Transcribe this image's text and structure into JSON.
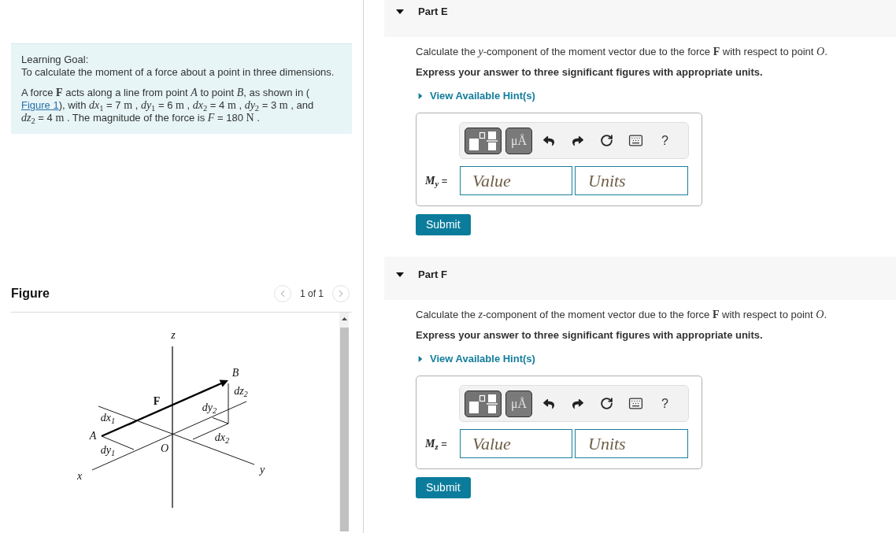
{
  "learning_goal": {
    "heading": "Learning Goal:",
    "goal": "To calculate the moment of a force about a point in three dimensions.",
    "problem": [
      {
        "kind": "text",
        "text": "A force "
      },
      {
        "kind": "math",
        "text": "**F**"
      },
      {
        "kind": "text",
        "text": " acts along a line from point "
      },
      {
        "kind": "math",
        "text": "*A*"
      },
      {
        "kind": "text",
        "text": " to point "
      },
      {
        "kind": "math",
        "text": "*B*"
      },
      {
        "kind": "text",
        "text": ", as shown in ( "
      },
      {
        "kind": "link",
        "text": "Figure 1"
      },
      {
        "kind": "text",
        "text": "), with "
      },
      {
        "kind": "math",
        "text": "*dx*$_{1}$"
      },
      {
        "kind": "text",
        "text": " = 7 "
      },
      {
        "kind": "math",
        "text": "m"
      },
      {
        "kind": "text",
        "text": " , "
      },
      {
        "kind": "math",
        "text": "*dy*$_{1}$"
      },
      {
        "kind": "text",
        "text": " = 6 "
      },
      {
        "kind": "math",
        "text": "m"
      },
      {
        "kind": "text",
        "text": " , "
      },
      {
        "kind": "math",
        "text": "*dx*$_{2}$"
      },
      {
        "kind": "text",
        "text": " = 4 "
      },
      {
        "kind": "math",
        "text": "m"
      },
      {
        "kind": "text",
        "text": " , "
      },
      {
        "kind": "math",
        "text": "*dy*$_{2}$"
      },
      {
        "kind": "text",
        "text": " = 3 "
      },
      {
        "kind": "math",
        "text": "m"
      },
      {
        "kind": "text",
        "text": " , and "
      },
      {
        "kind": "math",
        "text": "*dz*$_{2}$"
      },
      {
        "kind": "text",
        "text": " = 4 "
      },
      {
        "kind": "math",
        "text": "m"
      },
      {
        "kind": "text",
        "text": " . The magnitude of the force is "
      },
      {
        "kind": "math",
        "text": "*F*"
      },
      {
        "kind": "text",
        "text": " = 180 "
      },
      {
        "kind": "math",
        "text": "N"
      },
      {
        "kind": "text",
        "text": " ."
      }
    ]
  },
  "figure": {
    "title": "Figure",
    "pager": {
      "prev": {
        "disabled": true
      },
      "label": "1 of 1",
      "next": {
        "disabled": true
      }
    },
    "labels": [
      {
        "kind": "axis",
        "text": "z"
      },
      {
        "kind": "point",
        "text": "B"
      },
      {
        "kind": "dimension",
        "text": "dz$_{2}$"
      },
      {
        "kind": "force",
        "text": "F"
      },
      {
        "kind": "dimension",
        "text": "dy$_{2}$"
      },
      {
        "kind": "dimension",
        "text": "dx$_{1}$"
      },
      {
        "kind": "point",
        "text": "A"
      },
      {
        "kind": "dimension",
        "text": "dx$_{2}$"
      },
      {
        "kind": "dimension",
        "text": "dy$_{1}$"
      },
      {
        "kind": "point",
        "text": "O"
      },
      {
        "kind": "axis",
        "text": "y"
      },
      {
        "kind": "axis",
        "text": "x"
      }
    ]
  },
  "parts": [
    {
      "title": "Part E",
      "expanded": true,
      "question": [
        {
          "kind": "text",
          "text": "Calculate the "
        },
        {
          "kind": "math",
          "text": "*y*"
        },
        {
          "kind": "text",
          "text": "-component of the moment vector due to the force "
        },
        {
          "kind": "math",
          "text": "**F**"
        },
        {
          "kind": "text",
          "text": " with respect to point "
        },
        {
          "kind": "math",
          "text": "*O*"
        },
        {
          "kind": "text",
          "text": "."
        }
      ],
      "instruction": "Express your answer to three significant figures with appropriate units.",
      "hint": {
        "label": "View Available Hint(s)",
        "expanded": false
      },
      "answer": {
        "toolbar": [
          {
            "kind": "templates"
          },
          {
            "kind": "units",
            "label": "μÅ"
          },
          {
            "kind": "undo"
          },
          {
            "kind": "redo"
          },
          {
            "kind": "reset"
          },
          {
            "kind": "keyboard"
          },
          {
            "kind": "help",
            "label": "?"
          }
        ],
        "label": [
          {
            "kind": "variable",
            "text": "M$_{y}$"
          },
          {
            "kind": "text",
            "text": " ="
          }
        ],
        "value_placeholder": "Value",
        "units_placeholder": "Units"
      },
      "submit": "Submit"
    },
    {
      "title": "Part F",
      "expanded": true,
      "question": [
        {
          "kind": "text",
          "text": "Calculate the "
        },
        {
          "kind": "math",
          "text": "*z*"
        },
        {
          "kind": "text",
          "text": "-component of the moment vector due to the force "
        },
        {
          "kind": "math",
          "text": "**F**"
        },
        {
          "kind": "text",
          "text": " with respect to point "
        },
        {
          "kind": "math",
          "text": "*O*"
        },
        {
          "kind": "text",
          "text": "."
        }
      ],
      "instruction": "Express your answer to three significant figures with appropriate units.",
      "hint": {
        "label": "View Available Hint(s)",
        "expanded": false
      },
      "answer": {
        "toolbar": [
          {
            "kind": "templates"
          },
          {
            "kind": "units",
            "label": "μÅ"
          },
          {
            "kind": "undo"
          },
          {
            "kind": "redo"
          },
          {
            "kind": "reset"
          },
          {
            "kind": "keyboard"
          },
          {
            "kind": "help",
            "label": "?"
          }
        ],
        "label": [
          {
            "kind": "variable",
            "text": "M$_{z}$"
          },
          {
            "kind": "text",
            "text": " ="
          }
        ],
        "value_placeholder": "Value",
        "units_placeholder": "Units"
      },
      "submit": "Submit"
    }
  ]
}
